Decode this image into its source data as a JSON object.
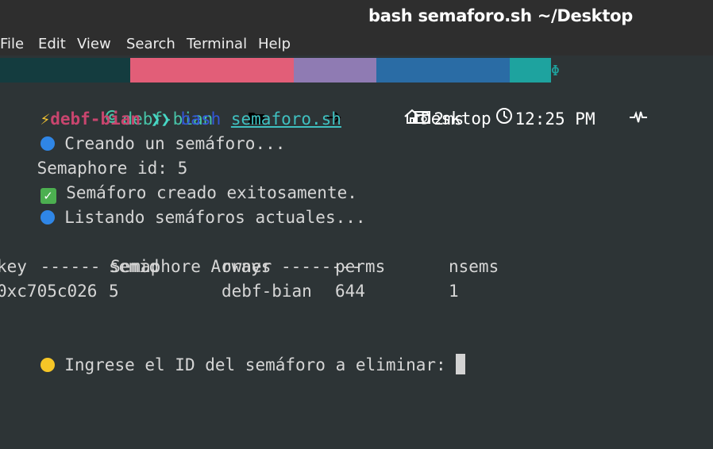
{
  "window": {
    "title": "bash semaforo.sh ~/Desktop"
  },
  "menu": [
    "File",
    "Edit",
    "View",
    "Search",
    "Terminal",
    "Help"
  ],
  "statusline": {
    "host": "debf-bian",
    "directory": "Desktop",
    "duration": "2ms",
    "clock": "12:25 PM",
    "separator": "Ξ",
    "tail_glyph": "Φ"
  },
  "prompt": {
    "user": "debf-bian",
    "arrows": "❯❯",
    "command": "bash",
    "argument": "semaforo.sh"
  },
  "output": {
    "creating": "Creando un semáforo...",
    "semaphore_id": "Semaphore id: 5",
    "created": "Semáforo creado exitosamente.",
    "listing": "Listando semáforos actuales...",
    "header": "------ Semaphore Arrays --------",
    "columns": [
      "key",
      "semid",
      "owner",
      "perms",
      "nsems"
    ],
    "rows": [
      [
        "0xc705c026",
        "5",
        "debf-bian",
        "644",
        "1"
      ]
    ],
    "input_prompt": "Ingrese el ID del semáforo a eliminar:"
  },
  "colors": {
    "background": "#2d3436",
    "host": "#143c3f",
    "directory": "#e25e78",
    "duration": "#8f7bb3",
    "clock": "#2a6ca5",
    "status": "#1ea39f"
  }
}
